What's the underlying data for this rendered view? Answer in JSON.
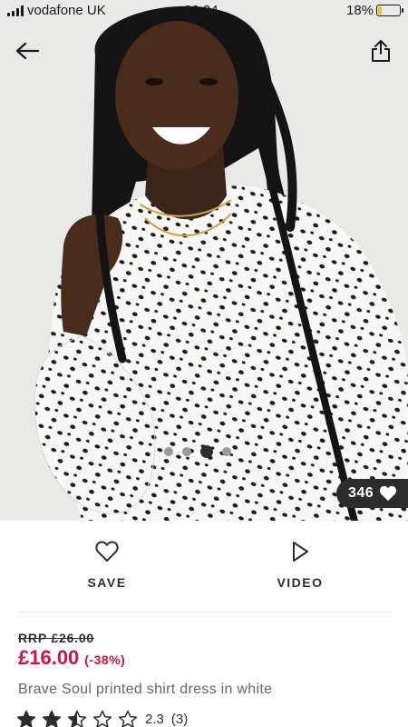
{
  "status_bar": {
    "carrier": "vodafone UK",
    "time": "20:24",
    "battery_percent": "18%",
    "battery_level": 0.18,
    "battery_color": "#f5c518"
  },
  "nav": {
    "back_icon": "arrow-left-icon",
    "share_icon": "share-icon"
  },
  "gallery": {
    "image_count": 4,
    "active_index": 2,
    "likes_count": "346",
    "likes_icon": "heart-filled-icon"
  },
  "actions": {
    "save_label": "SAVE",
    "save_icon": "heart-outline-icon",
    "video_label": "VIDEO",
    "video_icon": "play-icon"
  },
  "product": {
    "rrp": "RRP £26.00",
    "price": "£16.00",
    "discount": "(-38%)",
    "title": "Brave Soul printed shirt dress in white",
    "rating": 2.3,
    "rating_text": "2.3",
    "review_count": "(3)"
  },
  "colors": {
    "price": "#d01345",
    "text": "#2d2d2d",
    "pill_bg": "#2d2d2d"
  }
}
